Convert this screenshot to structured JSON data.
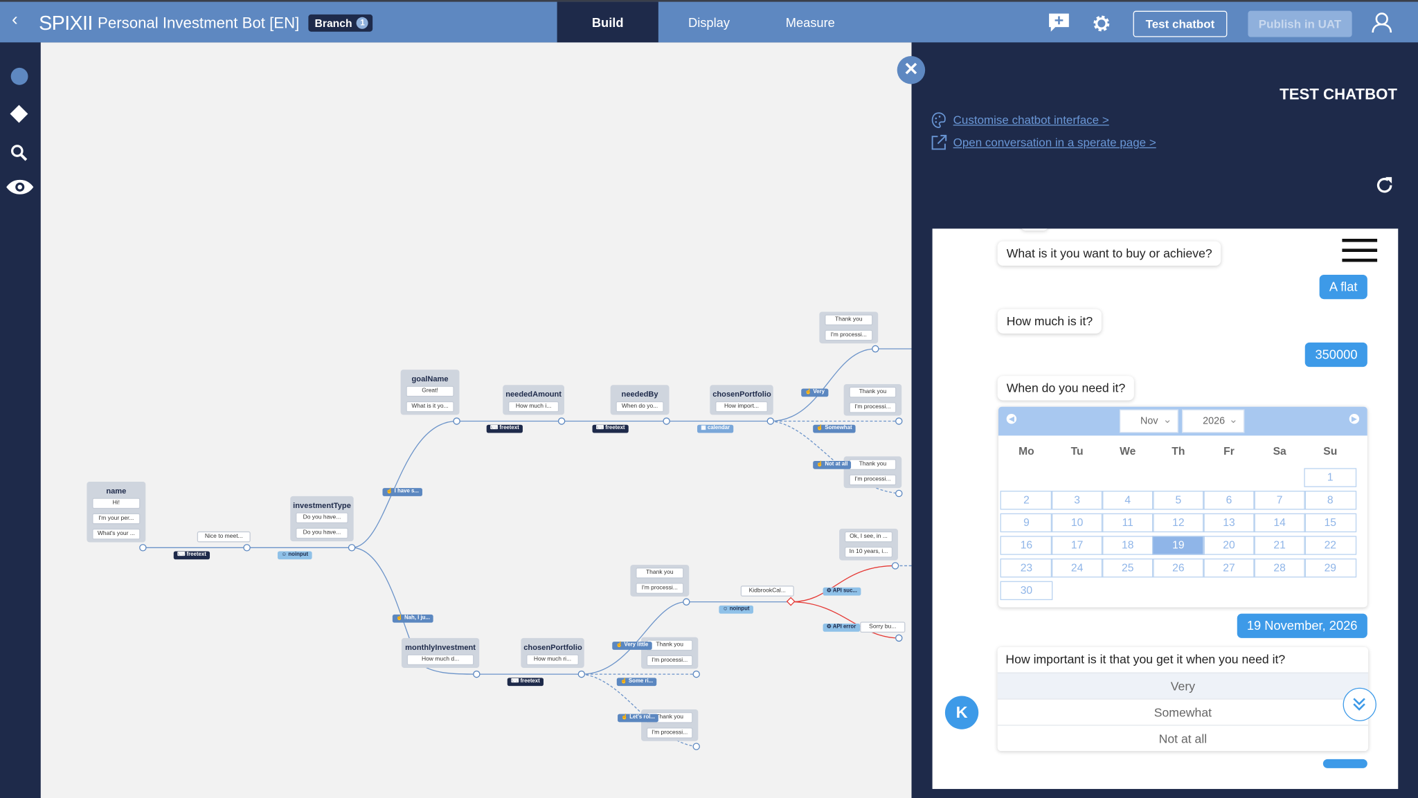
{
  "header": {
    "brand": "SPIXII",
    "title": "Personal Investment Bot [EN]",
    "branch_label": "Branch",
    "branch_count": "1",
    "tabs": [
      {
        "label": "Build",
        "active": true
      },
      {
        "label": "Display",
        "active": false
      },
      {
        "label": "Measure",
        "active": false
      }
    ],
    "test_chatbot_label": "Test chatbot",
    "publish_label": "Publish in UAT"
  },
  "sidebar": {
    "icons": [
      "circle-icon",
      "diamond-icon",
      "search-icon",
      "eye-icon"
    ]
  },
  "flow": {
    "nodes": [
      {
        "title": "name",
        "messages": [
          "Hi!",
          "I'm your per...",
          "What's your ..."
        ]
      },
      {
        "title": "",
        "messages": [
          "Nice to meet..."
        ]
      },
      {
        "title": "investmentType",
        "messages": [
          "Do you have...",
          "Do you have..."
        ]
      },
      {
        "title": "goalName",
        "messages": [
          "Great!",
          "What is it yo..."
        ]
      },
      {
        "title": "neededAmount",
        "messages": [
          "How much i..."
        ]
      },
      {
        "title": "neededBy",
        "messages": [
          "When do yo..."
        ]
      },
      {
        "title": "chosenPortfolio",
        "messages": [
          "How import..."
        ]
      },
      {
        "title": "",
        "messages": [
          "Thank you",
          "I'm processi..."
        ]
      },
      {
        "title": "",
        "messages": [
          "Thank you",
          "I'm processi..."
        ]
      },
      {
        "title": "",
        "messages": [
          "Thank you",
          "I'm processi..."
        ]
      },
      {
        "title": "monthlyInvestment",
        "messages": [
          "How much d..."
        ]
      },
      {
        "title": "chosenPortfolio",
        "messages": [
          "How much ri..."
        ]
      },
      {
        "title": "",
        "messages": [
          "Thank you",
          "I'm processi..."
        ]
      },
      {
        "title": "",
        "messages": [
          "Thank you",
          "I'm processi..."
        ]
      },
      {
        "title": "",
        "messages": [
          "Thank you",
          "I'm processi..."
        ]
      },
      {
        "title": "",
        "messages": [
          "KidbrookCal..."
        ]
      },
      {
        "title": "",
        "messages": [
          "Ok, I see, in ...",
          "In 10 years, i..."
        ]
      },
      {
        "title": "",
        "messages": [
          "Sorry bu..."
        ]
      }
    ],
    "edge_labels": [
      {
        "text": "freetext",
        "kind": "dark",
        "icon": "keyboard-icon"
      },
      {
        "text": "noinput",
        "kind": "light",
        "icon": "user-circle-icon"
      },
      {
        "text": "I have s...",
        "kind": "mid",
        "icon": "hand-pointer-icon"
      },
      {
        "text": "Nah, I ju...",
        "kind": "mid",
        "icon": "hand-pointer-icon"
      },
      {
        "text": "freetext",
        "kind": "dark",
        "icon": "keyboard-icon"
      },
      {
        "text": "freetext",
        "kind": "dark",
        "icon": "keyboard-icon"
      },
      {
        "text": "calendar",
        "kind": "cal",
        "icon": "calendar-icon"
      },
      {
        "text": "Very",
        "kind": "mid",
        "icon": "hand-pointer-icon"
      },
      {
        "text": "Somewhat",
        "kind": "mid",
        "icon": "hand-pointer-icon"
      },
      {
        "text": "Not at all",
        "kind": "mid",
        "icon": "hand-pointer-icon"
      },
      {
        "text": "freetext",
        "kind": "dark",
        "icon": "keyboard-icon"
      },
      {
        "text": "Very little",
        "kind": "mid",
        "icon": "hand-pointer-icon"
      },
      {
        "text": "Some ri...",
        "kind": "mid",
        "icon": "hand-pointer-icon"
      },
      {
        "text": "Let's rol...",
        "kind": "mid",
        "icon": "hand-pointer-icon"
      },
      {
        "text": "noinput",
        "kind": "light",
        "icon": "user-circle-icon"
      },
      {
        "text": "API suc...",
        "kind": "light",
        "icon": "gear-icon"
      },
      {
        "text": "API error",
        "kind": "light",
        "icon": "gear-icon"
      }
    ]
  },
  "test_panel": {
    "title": "TEST CHATBOT",
    "customise_link": "Customise chatbot interface >",
    "open_link": "Open conversation in a sperate page >"
  },
  "chat": {
    "messages": [
      {
        "from": "bot",
        "text": "What is it you want to buy or achieve?"
      },
      {
        "from": "user",
        "text": "A flat"
      },
      {
        "from": "bot",
        "text": "How much is it?"
      },
      {
        "from": "user",
        "text": "350000"
      },
      {
        "from": "bot",
        "text": "When do you need it?"
      },
      {
        "from": "user",
        "text": "19 November, 2026"
      }
    ],
    "calendar": {
      "month": "Nov",
      "year": "2026",
      "weekdays": [
        "Mo",
        "Tu",
        "We",
        "Th",
        "Fr",
        "Sa",
        "Su"
      ],
      "days_in_month": 30,
      "selected_day": 19
    },
    "question": {
      "text": "How important is it that you get it when you need it?",
      "options": [
        "Very",
        "Somewhat",
        "Not at all"
      ],
      "highlighted": "Very"
    },
    "avatar_letter": "K",
    "colors": {
      "user_bubble": "#3d9ae8",
      "header": "#5e88c1",
      "dark": "#1e2a4a",
      "calendar_accent": "#8fb5e8"
    }
  }
}
